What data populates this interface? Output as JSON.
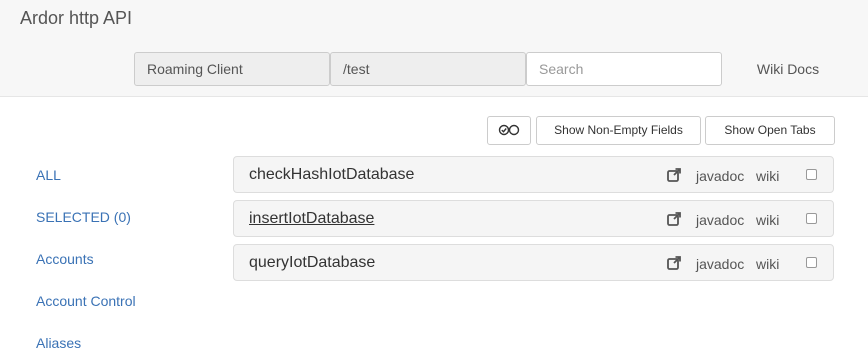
{
  "header": {
    "title": "Ardor http API",
    "client_mode": "Roaming Client",
    "path": "/test",
    "search_placeholder": "Search",
    "wiki_docs_label": "Wiki Docs"
  },
  "toolbar": {
    "toggle_icon": "check-circle-and-circle-icon",
    "show_non_empty_label": "Show Non-Empty Fields",
    "show_open_tabs_label": "Show Open Tabs"
  },
  "sidebar": {
    "items": [
      {
        "label": "ALL"
      },
      {
        "label": "SELECTED (0)"
      },
      {
        "label": "Accounts"
      },
      {
        "label": "Account Control"
      },
      {
        "label": "Aliases"
      }
    ]
  },
  "api_list": {
    "rows": [
      {
        "name": "checkHashIotDatabase",
        "javadoc": "javadoc",
        "wiki": "wiki",
        "checked": false
      },
      {
        "name": "insertIotDatabase",
        "javadoc": "javadoc",
        "wiki": "wiki",
        "checked": false
      },
      {
        "name": "queryIotDatabase",
        "javadoc": "javadoc",
        "wiki": "wiki",
        "checked": false
      }
    ]
  },
  "colors": {
    "link": "#3a72b5",
    "header_bg": "#f7f7f7",
    "row_bg": "#f5f5f5",
    "field_readonly_bg": "#eeeeee"
  }
}
